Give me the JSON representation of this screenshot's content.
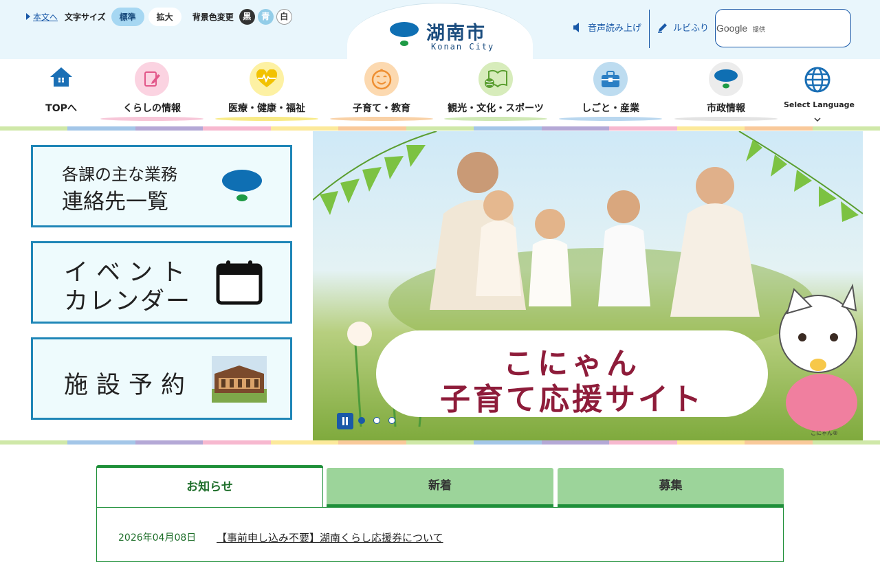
{
  "utility": {
    "skip_label": "本文へ",
    "font_size_label": "文字サイズ",
    "font_standard": "標準",
    "font_large": "拡大",
    "bg_color_label": "背景色変更",
    "bg_black": "黒",
    "bg_blue": "青",
    "bg_white": "白"
  },
  "site": {
    "name": "湖南市",
    "name_en": "Konan City"
  },
  "tools": {
    "voice_label": "音声読み上げ",
    "ruby_label": "ルビふり",
    "search_brand": "Google",
    "search_suffix": "提供"
  },
  "nav": {
    "top": "TOPへ",
    "living": "くらしの情報",
    "medical": "医療・健康・福祉",
    "child": "子育て・教育",
    "tourism": "観光・文化・スポーツ",
    "work": "しごと・産業",
    "city": "市政情報",
    "language": "Select Language"
  },
  "quick": {
    "contacts_line1": "各課の主な業務",
    "contacts_line2": "連絡先一覧",
    "event_line1": "イベント",
    "event_line2": "カレンダー",
    "facility": "施設予約"
  },
  "hero": {
    "line1": "こにゃん",
    "line2": "子育て応援サイト",
    "caption": "こにゃん®",
    "active_slide": 1,
    "slide_count": 3
  },
  "tabs": {
    "notice": "お知らせ",
    "new": "新着",
    "recruit": "募集",
    "active": "notice"
  },
  "news": [
    {
      "date": "2026年04月08日",
      "title": "【事前申し込み不要】湖南くらし応援券について"
    }
  ],
  "colors": {
    "brand_blue": "#1a59a8",
    "accent_green": "#1e8f39",
    "tab_green": "#9cd49a",
    "slide_text": "#8e1c3a"
  }
}
